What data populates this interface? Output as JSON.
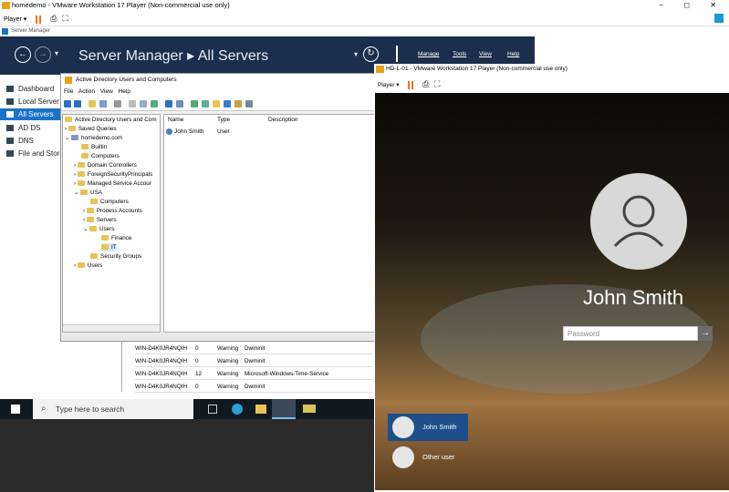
{
  "vmware": {
    "title": "homedemo - VMware Workstation 17 Player (Non-commercial use only)",
    "player_label": "Player ▾",
    "controls": "− ◻ ✕"
  },
  "server_manager": {
    "window_title": "Server Manager",
    "heading": "Server Manager ▸ All Servers",
    "menu": [
      "Manage",
      "Tools",
      "View",
      "Help"
    ],
    "sidebar": [
      {
        "label": "Dashboard"
      },
      {
        "label": "Local Server"
      },
      {
        "label": "All Servers"
      },
      {
        "label": "AD DS"
      },
      {
        "label": "DNS"
      },
      {
        "label": "File and Storage Services"
      }
    ]
  },
  "aduc": {
    "title": "Active Directory Users and Computers",
    "menu": "File Action View Help",
    "tree": [
      {
        "label": "Active Directory Users and Com"
      },
      {
        "label": "Saved Queries"
      },
      {
        "label": "homedemo.com"
      },
      {
        "label": "Builtin"
      },
      {
        "label": "Computers"
      },
      {
        "label": "Domain Controllers"
      },
      {
        "label": "ForeignSecurityPrincipals"
      },
      {
        "label": "Managed Service Accour"
      },
      {
        "label": "USA"
      },
      {
        "label": "Computers"
      },
      {
        "label": "Process Accounts"
      },
      {
        "label": "Servers"
      },
      {
        "label": "Users"
      },
      {
        "label": "Finance"
      },
      {
        "label": "IT"
      },
      {
        "label": "Security Groups"
      },
      {
        "label": "Users"
      }
    ],
    "columns": [
      "Name",
      "Type",
      "Description"
    ],
    "rows": [
      {
        "name": "John Smith",
        "type": "User",
        "description": ""
      }
    ]
  },
  "events": [
    {
      "server": "WIN-D4K0JR4NQIH",
      "id": "0",
      "severity": "Warning",
      "source": "Dwminit"
    },
    {
      "server": "WIN-D4K0JR4NQIH",
      "id": "0",
      "severity": "Warning",
      "source": "Dwminit"
    },
    {
      "server": "WIN-D4K0JR4NQIH",
      "id": "12",
      "severity": "Warning",
      "source": "Microsoft-Windows-Time-Service"
    },
    {
      "server": "WIN-D4K0JR4NQIH",
      "id": "0",
      "severity": "Warning",
      "source": "Dwminit"
    }
  ],
  "taskbar": {
    "search_placeholder": "Type here to search"
  },
  "vm2": {
    "title": "HD-L-01 - VMware Workstation 17 Player (Non-commercial use only)",
    "player_label": "Player ▾",
    "user_name": "John Smith",
    "password_placeholder": "Password",
    "users": [
      "John Smith",
      "Other user"
    ]
  }
}
